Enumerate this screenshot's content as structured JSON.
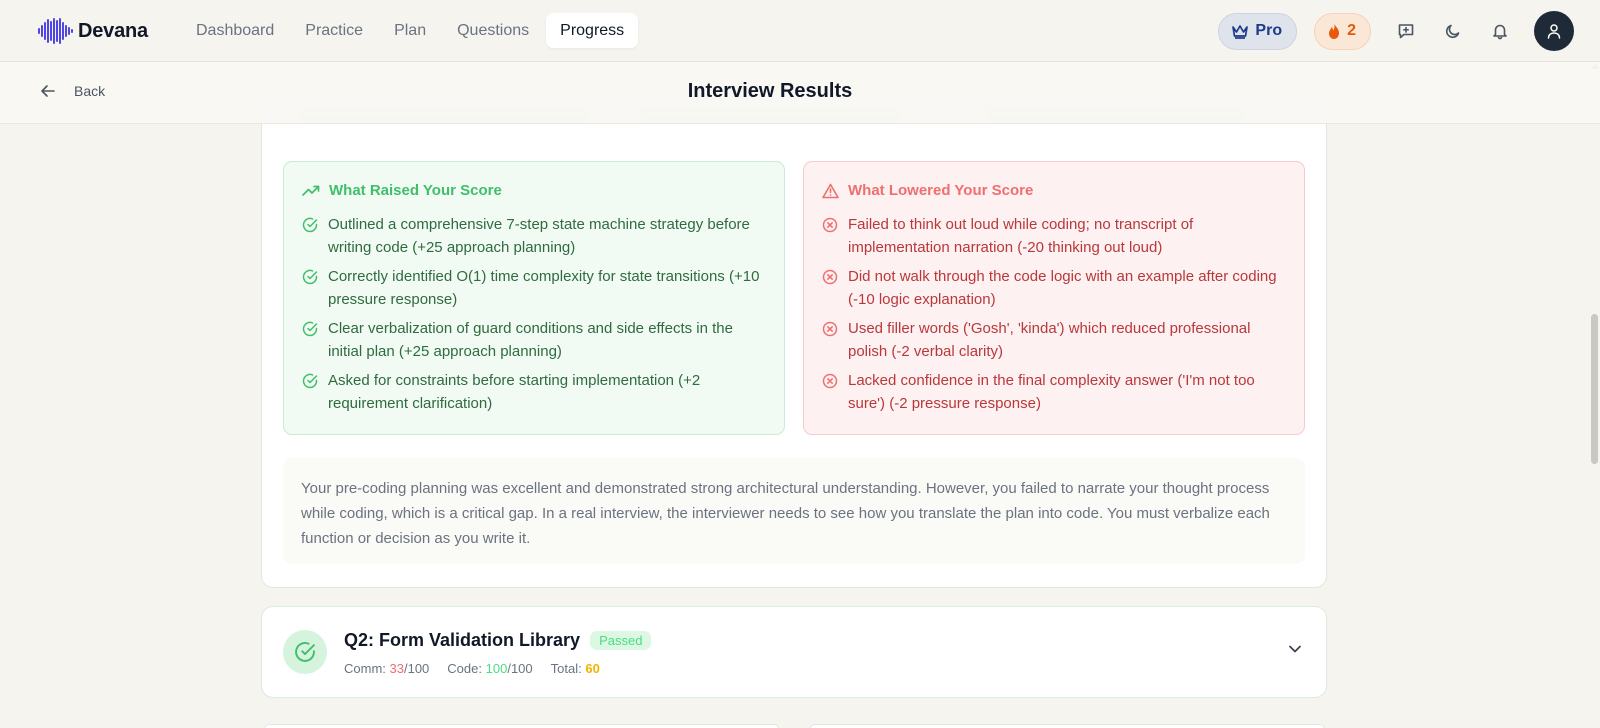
{
  "nav": {
    "brand": "Devana",
    "items": [
      {
        "label": "Dashboard",
        "active": false
      },
      {
        "label": "Practice",
        "active": false
      },
      {
        "label": "Plan",
        "active": false
      },
      {
        "label": "Questions",
        "active": false
      },
      {
        "label": "Progress",
        "active": true
      }
    ],
    "pro_label": "Pro",
    "streak_count": "2",
    "icons": [
      "crown-icon",
      "flame-icon",
      "feedback-icon",
      "moon-icon",
      "bell-icon",
      "user-icon"
    ]
  },
  "subheader": {
    "back_label": "Back",
    "title": "Interview Results"
  },
  "feedback": {
    "raised": {
      "title": "What Raised Your Score",
      "items": [
        "Outlined a comprehensive 7-step state machine strategy before writing code (+25 approach planning)",
        "Correctly identified O(1) time complexity for state transitions (+10 pressure response)",
        "Clear verbalization of guard conditions and side effects in the initial plan (+25 approach planning)",
        "Asked for constraints before starting implementation (+2 requirement clarification)"
      ]
    },
    "lowered": {
      "title": "What Lowered Your Score",
      "items": [
        "Failed to think out loud while coding; no transcript of implementation narration (-20 thinking out loud)",
        "Did not walk through the code logic with an example after coding (-10 logic explanation)",
        "Used filler words ('Gosh', 'kinda') which reduced professional polish (-2 verbal clarity)",
        "Lacked confidence in the final complexity answer ('I'm not too sure') (-2 pressure response)"
      ]
    },
    "summary": "Your pre-coding planning was excellent and demonstrated strong architectural understanding. However, you failed to narrate your thought process while coding, which is a critical gap. In a real interview, the interviewer needs to see how you translate the plan into code. You must verbalize each function or decision as you write it."
  },
  "question2": {
    "title": "Q2: Form Validation Library",
    "badge": "Passed",
    "comm_label": "Comm:",
    "comm_value": "33",
    "code_label": "Code:",
    "code_value": "100",
    "total_label": "Total:",
    "total_value": "60",
    "out_of": "/100"
  },
  "colors": {
    "good": "#3fbf6a",
    "bad": "#ef6f6f",
    "streak": "#ea580c",
    "pro": "#1e3a8a",
    "total": "#f5b400"
  }
}
